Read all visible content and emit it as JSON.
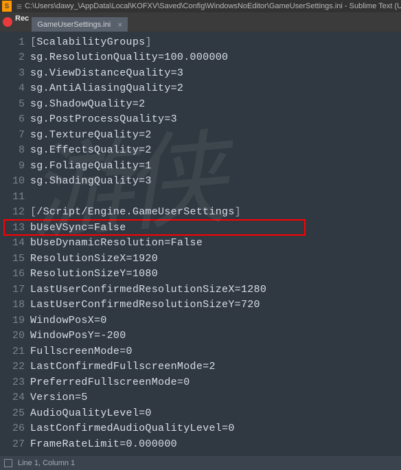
{
  "title": "C:\\Users\\dawy_\\AppData\\Local\\KOFXV\\Saved\\Config\\WindowsNoEditor\\GameUserSettings.ini - Sublime Text (UNREGISTERED)",
  "rec": "Rec",
  "tab": {
    "label": "GameUserSettings.ini",
    "close": "×"
  },
  "menu_glyph": "≡",
  "lines": [
    {
      "n": "1",
      "t": "[ScalabilityGroups]",
      "bracket": true
    },
    {
      "n": "2",
      "t": "sg.ResolutionQuality=100.000000"
    },
    {
      "n": "3",
      "t": "sg.ViewDistanceQuality=3"
    },
    {
      "n": "4",
      "t": "sg.AntiAliasingQuality=2"
    },
    {
      "n": "5",
      "t": "sg.ShadowQuality=2"
    },
    {
      "n": "6",
      "t": "sg.PostProcessQuality=3"
    },
    {
      "n": "7",
      "t": "sg.TextureQuality=2"
    },
    {
      "n": "8",
      "t": "sg.EffectsQuality=2"
    },
    {
      "n": "9",
      "t": "sg.FoliageQuality=1"
    },
    {
      "n": "10",
      "t": "sg.ShadingQuality=3"
    },
    {
      "n": "11",
      "t": ""
    },
    {
      "n": "12",
      "t": "[/Script/Engine.GameUserSettings]",
      "bracket": true
    },
    {
      "n": "13",
      "t": "bUseVSync=False"
    },
    {
      "n": "14",
      "t": "bUseDynamicResolution=False"
    },
    {
      "n": "15",
      "t": "ResolutionSizeX=1920"
    },
    {
      "n": "16",
      "t": "ResolutionSizeY=1080"
    },
    {
      "n": "17",
      "t": "LastUserConfirmedResolutionSizeX=1280"
    },
    {
      "n": "18",
      "t": "LastUserConfirmedResolutionSizeY=720"
    },
    {
      "n": "19",
      "t": "WindowPosX=0"
    },
    {
      "n": "20",
      "t": "WindowPosY=-200"
    },
    {
      "n": "21",
      "t": "FullscreenMode=0"
    },
    {
      "n": "22",
      "t": "LastConfirmedFullscreenMode=2"
    },
    {
      "n": "23",
      "t": "PreferredFullscreenMode=0"
    },
    {
      "n": "24",
      "t": "Version=5"
    },
    {
      "n": "25",
      "t": "AudioQualityLevel=0"
    },
    {
      "n": "26",
      "t": "LastConfirmedAudioQualityLevel=0"
    },
    {
      "n": "27",
      "t": "FrameRateLimit=0.000000"
    }
  ],
  "status": "Line 1, Column 1",
  "watermark": "游侠"
}
